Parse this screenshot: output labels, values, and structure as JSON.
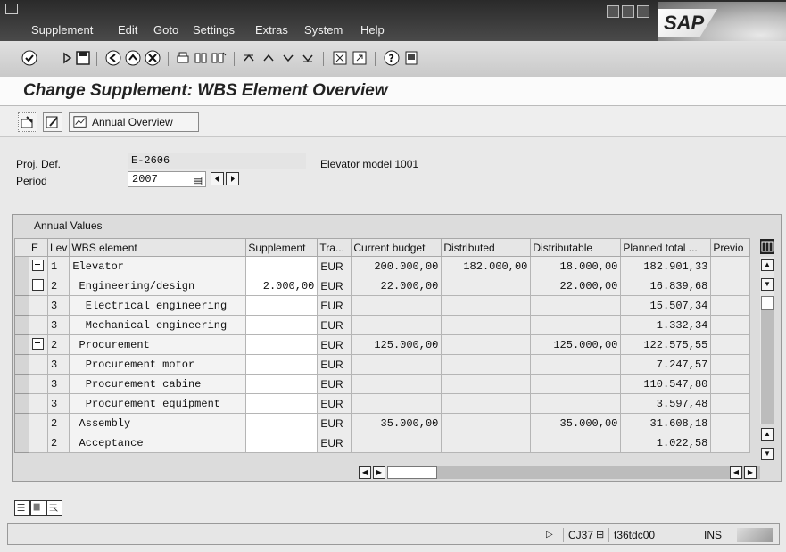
{
  "menu": [
    "Supplement",
    "Edit",
    "Goto",
    "Settings",
    "Extras",
    "System",
    "Help"
  ],
  "logo": "SAP",
  "title": "Change Supplement: WBS Element Overview",
  "app_toolbar": {
    "annual_overview_label": "Annual Overview"
  },
  "header": {
    "proj_def_label": "Proj. Def.",
    "proj_def_value": "E-2606",
    "proj_def_desc": "Elevator model 1001",
    "period_label": "Period",
    "period_value": "2007"
  },
  "table": {
    "title": "Annual Values",
    "columns": [
      "E",
      "Lev",
      "WBS element",
      "Supplement",
      "Tra...",
      "Current budget",
      "Distributed",
      "Distributable",
      "Planned total ...",
      "Previo"
    ],
    "rows": [
      {
        "icon": true,
        "lev": "1",
        "wbs": "Elevator",
        "supp": "",
        "cur": "EUR",
        "budget": "200.000,00",
        "dist": "182.000,00",
        "distable": "18.000,00",
        "planned": "182.901,33"
      },
      {
        "icon": true,
        "lev": "2",
        "wbs": " Engineering/design",
        "supp": "2.000,00",
        "cur": "EUR",
        "budget": "22.000,00",
        "dist": "",
        "distable": "22.000,00",
        "planned": "16.839,68"
      },
      {
        "icon": false,
        "lev": "3",
        "wbs": "  Electrical engineering",
        "supp": "",
        "cur": "EUR",
        "budget": "",
        "dist": "",
        "distable": "",
        "planned": "15.507,34"
      },
      {
        "icon": false,
        "lev": "3",
        "wbs": "  Mechanical engineering",
        "supp": "",
        "cur": "EUR",
        "budget": "",
        "dist": "",
        "distable": "",
        "planned": "1.332,34"
      },
      {
        "icon": true,
        "lev": "2",
        "wbs": " Procurement",
        "supp": "",
        "cur": "EUR",
        "budget": "125.000,00",
        "dist": "",
        "distable": "125.000,00",
        "planned": "122.575,55"
      },
      {
        "icon": false,
        "lev": "3",
        "wbs": "  Procurement motor",
        "supp": "",
        "cur": "EUR",
        "budget": "",
        "dist": "",
        "distable": "",
        "planned": "7.247,57"
      },
      {
        "icon": false,
        "lev": "3",
        "wbs": "  Procurement cabine",
        "supp": "",
        "cur": "EUR",
        "budget": "",
        "dist": "",
        "distable": "",
        "planned": "110.547,80"
      },
      {
        "icon": false,
        "lev": "3",
        "wbs": "  Procurement equipment",
        "supp": "",
        "cur": "EUR",
        "budget": "",
        "dist": "",
        "distable": "",
        "planned": "3.597,48"
      },
      {
        "icon": false,
        "lev": "2",
        "wbs": " Assembly",
        "supp": "",
        "cur": "EUR",
        "budget": "35.000,00",
        "dist": "",
        "distable": "35.000,00",
        "planned": "31.608,18"
      },
      {
        "icon": false,
        "lev": "2",
        "wbs": " Acceptance",
        "supp": "",
        "cur": "EUR",
        "budget": "",
        "dist": "",
        "distable": "",
        "planned": "1.022,58"
      }
    ]
  },
  "status": {
    "transaction": "CJ37",
    "server": "t36tdc00",
    "mode": "INS"
  }
}
